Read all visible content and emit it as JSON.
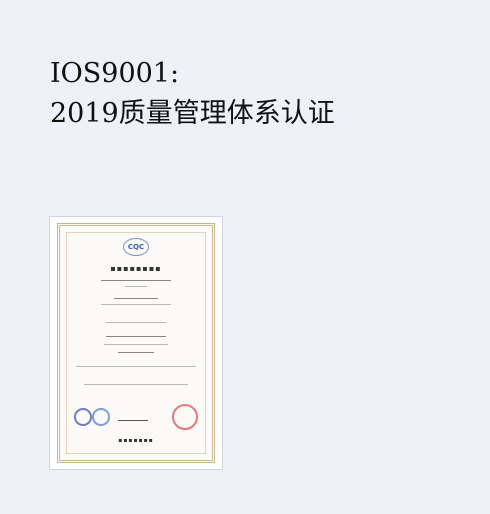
{
  "heading": {
    "line1": "IOS9001:",
    "line2": "2019质量管理体系认证"
  },
  "certificate": {
    "icon": "certificate-image"
  }
}
